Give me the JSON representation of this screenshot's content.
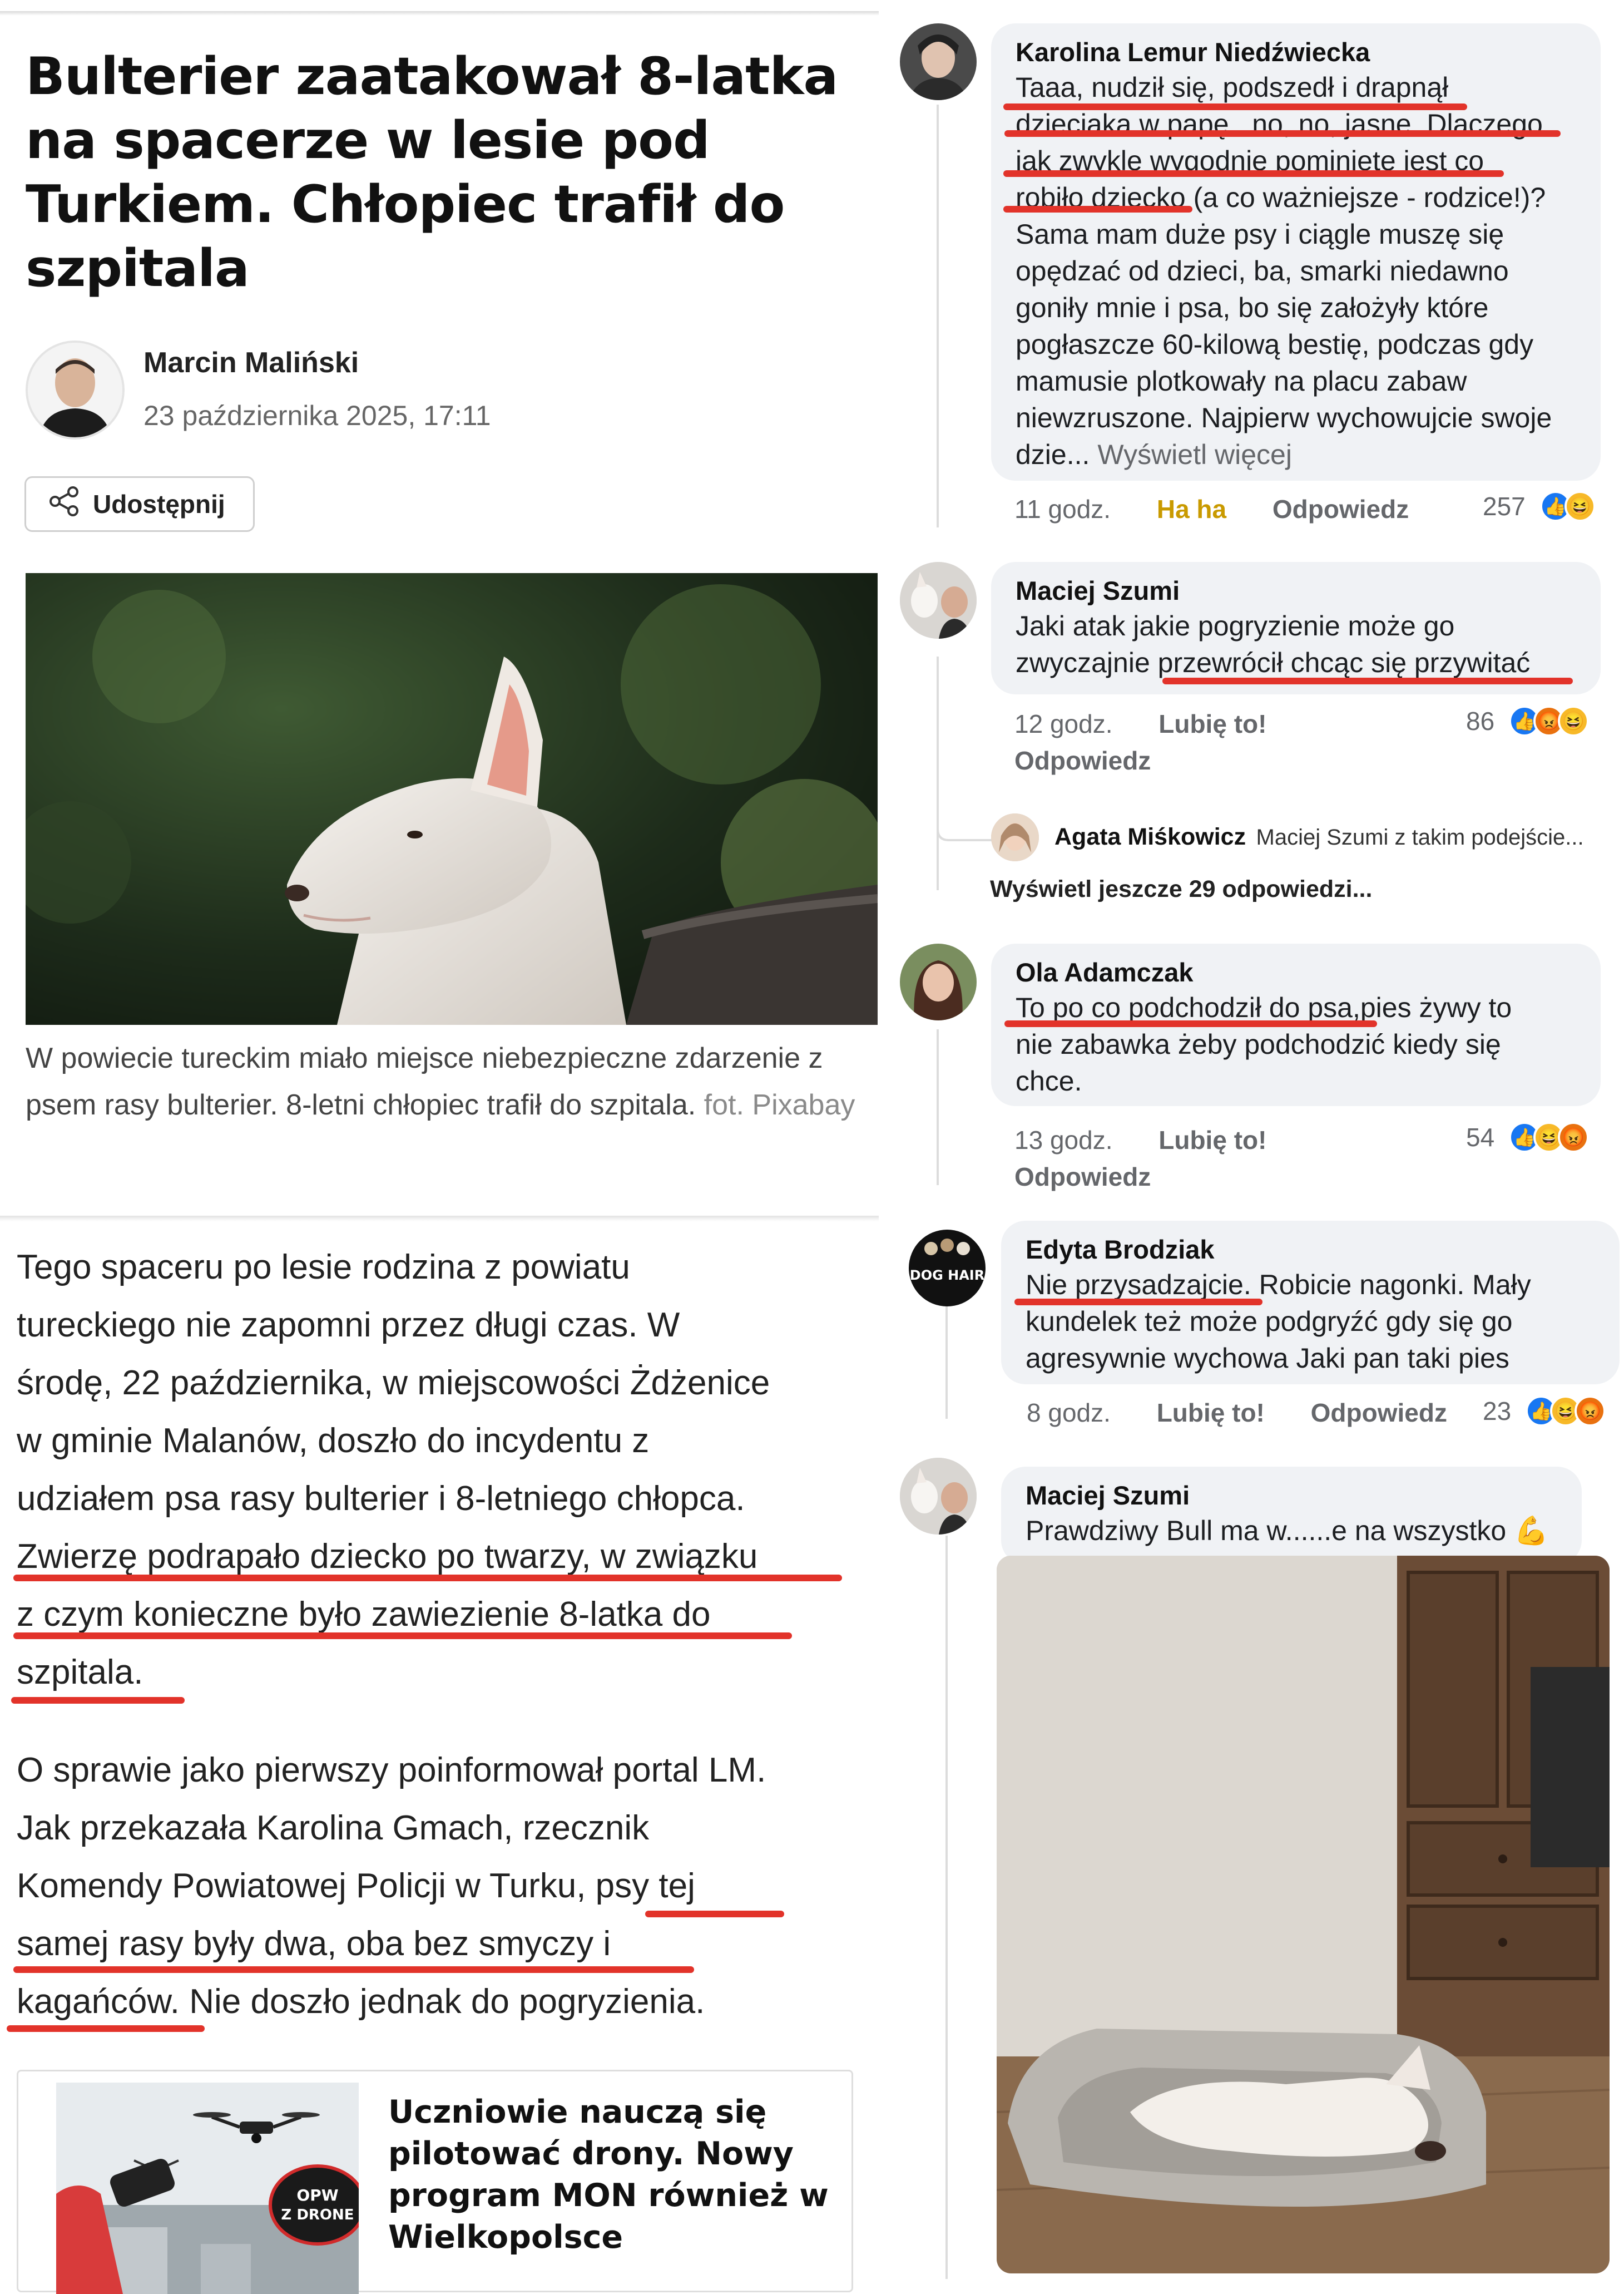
{
  "article": {
    "headline": "Bulterier zaatakował 8-latka na spacerze w lesie pod Turkiem. Chłopiec trafił do szpitala",
    "author": "Marcin Maliński",
    "date": "23 października 2025, 17:11",
    "share_label": "Udostępnij",
    "photo_alt": "Bulterier - zdjęcie",
    "caption": "W powiecie tureckim miało miejsce niebezpieczne zdarzenie z psem rasy bulterier. 8-letni chłopiec trafił do szpitala.",
    "caption_credit": "fot. Pixabay",
    "paragraph1_lines": [
      "Tego spaceru po lesie rodzina z powiatu",
      "tureckiego nie zapomni przez długi czas. W",
      "środę, 22 października, w miejscowości Żdżenice",
      "w gminie Malanów, doszło do incydentu z",
      "udziałem psa rasy bulterier i 8-letniego chłopca.",
      "Zwierzę podrapało dziecko po twarzy, w związku",
      "z czym konieczne było zawiezienie 8-latka do",
      "szpitala."
    ],
    "paragraph2_lines": [
      "O sprawie jako pierwszy poinformował portal LM.",
      "Jak przekazała Karolina Gmach, rzecznik",
      "Komendy Powiatowej Policji w Turku, psy tej",
      "samej rasy były dwa, oba bez smyczy i",
      "kagańców. Nie doszło jednak do pogryzienia."
    ],
    "related": {
      "title": "Uczniowie nauczą się pilotować drony. Nowy program MON również w Wielkopolsce",
      "badge": "OPW Z DRONEM"
    }
  },
  "comments": [
    {
      "author": "Karolina Lemur Niedźwiecka",
      "lines": [
        "Taaa, nudził się, podszedł i drapnął",
        "dzieciaka w papę.. no, no, jasne. Dlaczego",
        "jak zwykle wygodnie pominięte jest co",
        "robiło dziecko (a co ważniejsze - rodzice!)?",
        "Sama mam duże psy i ciągle muszę się",
        "opędzać od dzieci, ba, smarki niedawno",
        "goniły mnie i psa, bo się założyły które",
        "pogłaszcze 60-kilową bestię, podczas gdy",
        "mamusie plotkowały na placu zabaw",
        "niewzruszone. Najpierw wychowujcie swoje"
      ],
      "last_line": "dzie...",
      "see_more": "Wyświetl więcej",
      "time": "11 godz.",
      "action1": "Ha ha",
      "action2": "Odpowiedz",
      "reactions": "257"
    },
    {
      "author": "Maciej Szumi",
      "lines": [
        "Jaki atak jakie pogryzienie może go",
        "zwyczajnie przewrócił chcąc się przywitać"
      ],
      "time": "12 godz.",
      "action1": "Lubię to!",
      "action2": "Odpowiedz",
      "reactions": "86",
      "reply": {
        "author": "Agata Miśkowicz",
        "text": "Maciej Szumi z takim podejście..."
      },
      "more_replies": "Wyświetl jeszcze 29 odpowiedzi..."
    },
    {
      "author": "Ola Adamczak",
      "lines": [
        "To po co podchodził do psa,pies żywy to",
        "nie zabawka żeby podchodzić kiedy się",
        "chce."
      ],
      "time": "13 godz.",
      "action1": "Lubię to!",
      "action2": "Odpowiedz",
      "reactions": "54"
    },
    {
      "author": "Edyta Brodziak",
      "avatar_text": "DOG HAIR",
      "lines": [
        "Nie przysadzajcie. Robicie nagonki. Mały",
        "kundelek też może podgryźć gdy się go",
        "agresywnie wychowa   Jaki pan taki pies"
      ],
      "time": "8 godz.",
      "action1": "Lubię to!",
      "action2": "Odpowiedz",
      "reactions": "23"
    },
    {
      "author": "Maciej Szumi",
      "lines": [
        "Prawdziwy Bull ma w......e na wszystko"
      ],
      "photo_alt": "Bulterier śpiący w legowisku"
    }
  ],
  "colors": {
    "highlight": "#e2332a",
    "bubble": "#f0f2f5",
    "like": "#1877f2",
    "haha": "#f7b928",
    "angry": "#e9710f"
  }
}
